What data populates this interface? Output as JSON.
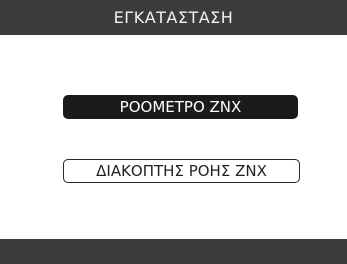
{
  "header": {
    "title": "ΕΓΚΑΤΑΣΤΑΣΗ"
  },
  "menu": {
    "items": [
      {
        "label": "ΡΟΟΜΕΤΡΟ ZNX",
        "selected": true
      },
      {
        "label": "ΔΙΑΚΟΠΤΗΣ ΡΟΗΣ ZNX",
        "selected": false
      }
    ]
  },
  "colors": {
    "bar": "#3c3c3c",
    "selected_bg": "#1d1a1a",
    "background": "#ffffff"
  }
}
